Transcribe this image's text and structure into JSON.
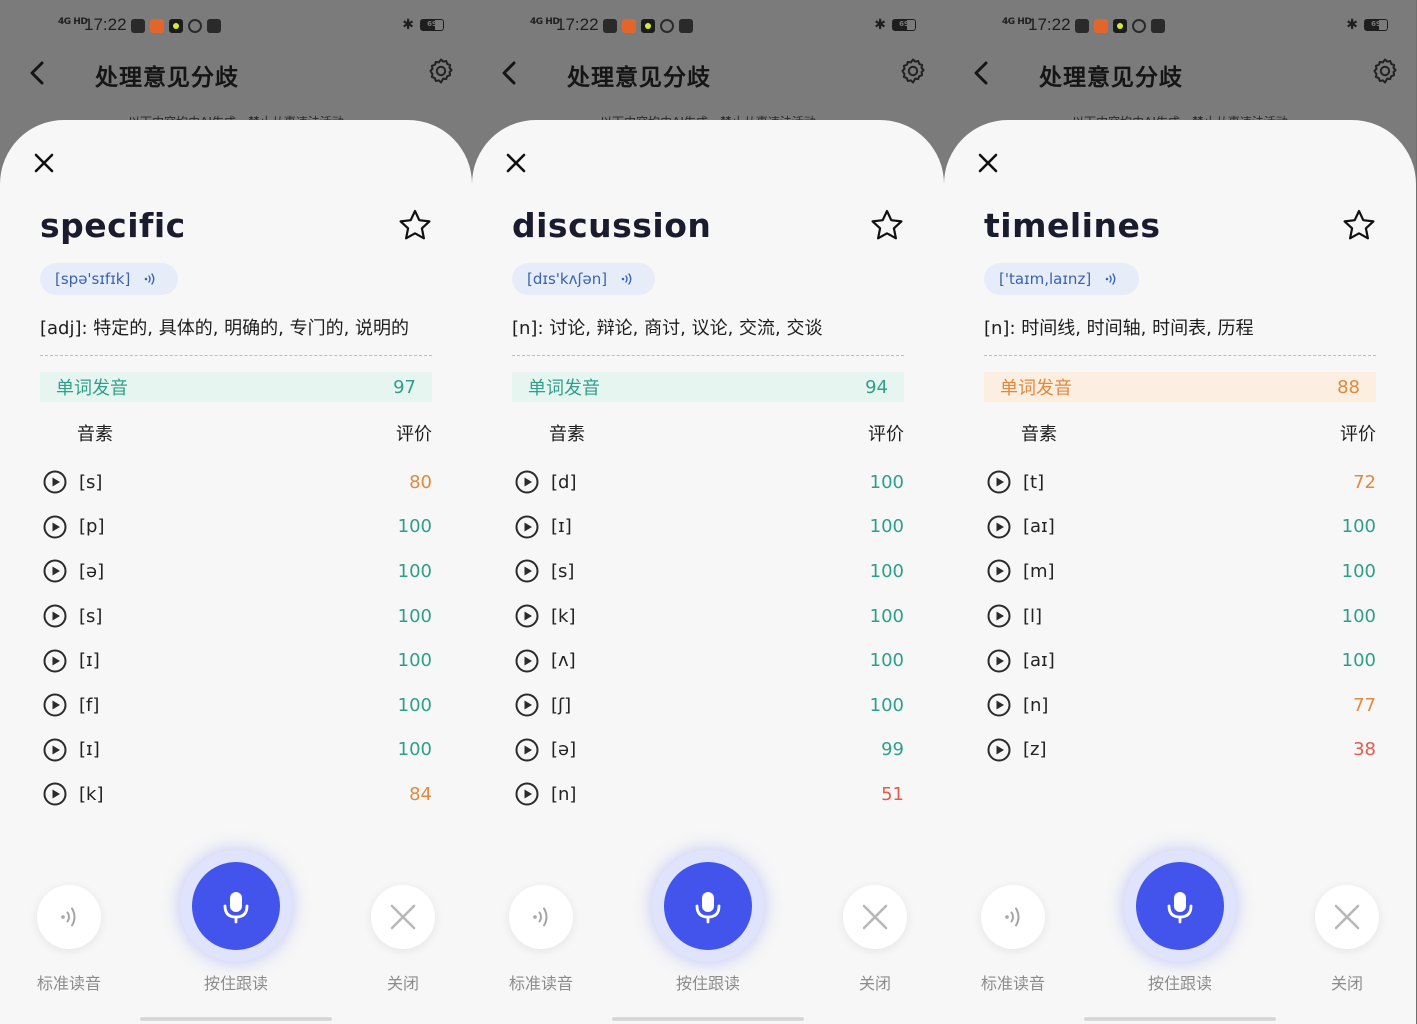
{
  "status_bar": {
    "network": "4G HD",
    "time": "17:22",
    "battery": "69"
  },
  "header": {
    "title": "处理意见分歧",
    "notice": "以下内容均由AI生成，禁止从事违法活动"
  },
  "colors": {
    "good": "#2f9f89",
    "warn": "#e08a3f",
    "bad": "#e45b4b",
    "mic": "#4254ec"
  },
  "labels": {
    "score_label": "单词发音",
    "phoneme_col": "音素",
    "rating_col": "评价",
    "std_btn": "标准读音",
    "mic_btn": "按住跟读",
    "close_btn": "关闭"
  },
  "cards": [
    {
      "word": "specific",
      "phonetic": "[spə'sɪfɪk]",
      "definition": "[adj]: 特定的, 具体的, 明确的, 专门的, 说明的",
      "score": "97",
      "score_level": "good",
      "phonemes": [
        {
          "p": "[s]",
          "s": "80",
          "level": "warn"
        },
        {
          "p": "[p]",
          "s": "100",
          "level": "good"
        },
        {
          "p": "[ə]",
          "s": "100",
          "level": "good"
        },
        {
          "p": "[s]",
          "s": "100",
          "level": "good"
        },
        {
          "p": "[ɪ]",
          "s": "100",
          "level": "good"
        },
        {
          "p": "[f]",
          "s": "100",
          "level": "good"
        },
        {
          "p": "[ɪ]",
          "s": "100",
          "level": "good"
        },
        {
          "p": "[k]",
          "s": "84",
          "level": "warn"
        }
      ]
    },
    {
      "word": "discussion",
      "phonetic": "[dɪs'kʌʃən]",
      "definition": "[n]: 讨论, 辩论, 商讨, 议论, 交流, 交谈",
      "score": "94",
      "score_level": "good",
      "phonemes": [
        {
          "p": "[d]",
          "s": "100",
          "level": "good"
        },
        {
          "p": "[ɪ]",
          "s": "100",
          "level": "good"
        },
        {
          "p": "[s]",
          "s": "100",
          "level": "good"
        },
        {
          "p": "[k]",
          "s": "100",
          "level": "good"
        },
        {
          "p": "[ʌ]",
          "s": "100",
          "level": "good"
        },
        {
          "p": "[ʃ]",
          "s": "100",
          "level": "good"
        },
        {
          "p": "[ə]",
          "s": "99",
          "level": "good"
        },
        {
          "p": "[n]",
          "s": "51",
          "level": "bad"
        }
      ]
    },
    {
      "word": "timelines",
      "phonetic": "['taɪm,laɪnz]",
      "definition": "[n]: 时间线, 时间轴, 时间表, 历程",
      "score": "88",
      "score_level": "warn",
      "phonemes": [
        {
          "p": "[t]",
          "s": "72",
          "level": "warn"
        },
        {
          "p": "[aɪ]",
          "s": "100",
          "level": "good"
        },
        {
          "p": "[m]",
          "s": "100",
          "level": "good"
        },
        {
          "p": "[l]",
          "s": "100",
          "level": "good"
        },
        {
          "p": "[aɪ]",
          "s": "100",
          "level": "good"
        },
        {
          "p": "[n]",
          "s": "77",
          "level": "warn"
        },
        {
          "p": "[z]",
          "s": "38",
          "level": "bad"
        }
      ]
    }
  ]
}
